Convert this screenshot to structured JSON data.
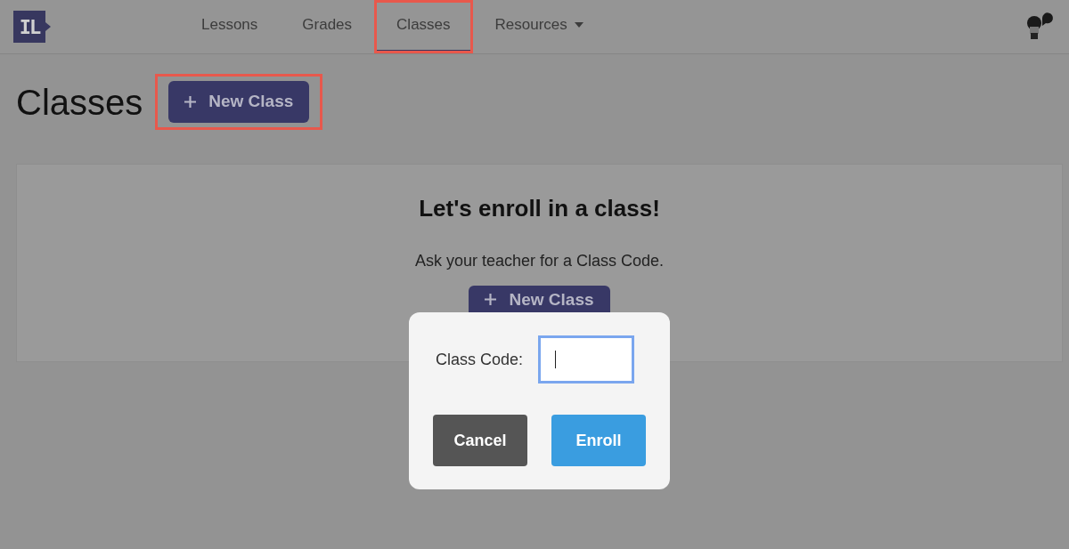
{
  "header": {
    "logo": "IL",
    "nav": [
      {
        "label": "Lessons",
        "selected": false,
        "dropdown": false
      },
      {
        "label": "Grades",
        "selected": false,
        "dropdown": false
      },
      {
        "label": "Classes",
        "selected": true,
        "dropdown": false,
        "highlighted": true
      },
      {
        "label": "Resources",
        "selected": false,
        "dropdown": true
      }
    ]
  },
  "page": {
    "title": "Classes",
    "new_button": {
      "label": "New Class",
      "highlighted": true
    }
  },
  "card": {
    "heading": "Let's enroll in a class!",
    "text": "Ask your teacher for a Class Code.",
    "button": "New Class"
  },
  "dialog": {
    "label": "Class Code:",
    "input": {
      "focused": true
    },
    "buttons": [
      {
        "label": "Cancel",
        "kind": "secondary"
      },
      {
        "label": "Enroll",
        "kind": "primary"
      }
    ]
  }
}
